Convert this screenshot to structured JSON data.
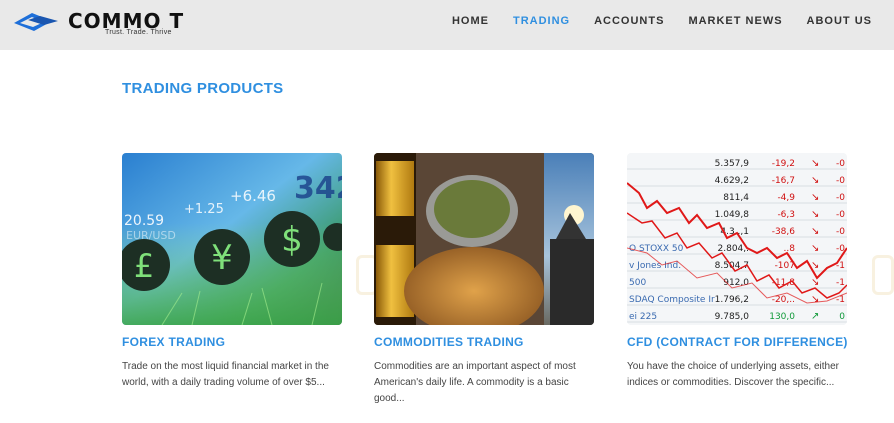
{
  "brand": {
    "name": "COMMO T",
    "tagline": "Trust. Trade. Thrive",
    "logo_color": "#1e6fd9"
  },
  "nav": {
    "items": [
      "HOME",
      "TRADING",
      "ACCOUNTS",
      "MARKET NEWS",
      "ABOUT US"
    ],
    "active": "TRADING"
  },
  "section": {
    "title": "TRADING PRODUCTS"
  },
  "cards": [
    {
      "title": "FOREX TRADING",
      "text": "Trade on the most liquid financial market in the world, with a daily trading volume of over $5...",
      "image": "forex-currency-symbols"
    },
    {
      "title": "COMMODITIES TRADING",
      "text": "Commodities are an important aspect of most American's daily life. A commodity is a basic good...",
      "image": "commodities-gold-grain-oil"
    },
    {
      "title": "CFD (CONTRACT FOR DIFFERENCE)",
      "text": "You have the choice of underlying assets, either indices or commodities. Discover the specific...",
      "image": "stock-market-board"
    }
  ],
  "images": {
    "forex": {
      "numbers": [
        "342",
        "+6.46",
        "+1.25",
        "20.59",
        "EUR/USD"
      ],
      "symbols": [
        "£",
        "¥",
        "$"
      ]
    },
    "cfd": {
      "rows": [
        {
          "name": "",
          "value": "5.357,9",
          "change": "-19,2",
          "pct": "-0"
        },
        {
          "name": "",
          "value": "4.629,2",
          "change": "-16,7",
          "pct": "-0"
        },
        {
          "name": "",
          "value": "811,4",
          "change": "-4,9",
          "pct": "-0"
        },
        {
          "name": "",
          "value": "1.049,8",
          "change": "-6,3",
          "pct": "-0"
        },
        {
          "name": "",
          "value": "4.3..,1",
          "change": "-38,6",
          "pct": "-0"
        },
        {
          "name": "O STOXX 50",
          "value": "2.804,.",
          "change": "..8",
          "pct": "-0"
        },
        {
          "name": "v Jones Ind.",
          "value": "8.504,7",
          "change": "-107",
          "pct": "-1"
        },
        {
          "name": "500",
          "value": "912,0",
          "change": "-11,8",
          "pct": "-1"
        },
        {
          "name": "SDAQ Composite Ir",
          "value": "1.796,2",
          "change": "-20,..",
          "pct": "-1"
        },
        {
          "name": "ei 225",
          "value": "9.785,0",
          "change": "130,0",
          "pct": "0"
        }
      ]
    }
  }
}
